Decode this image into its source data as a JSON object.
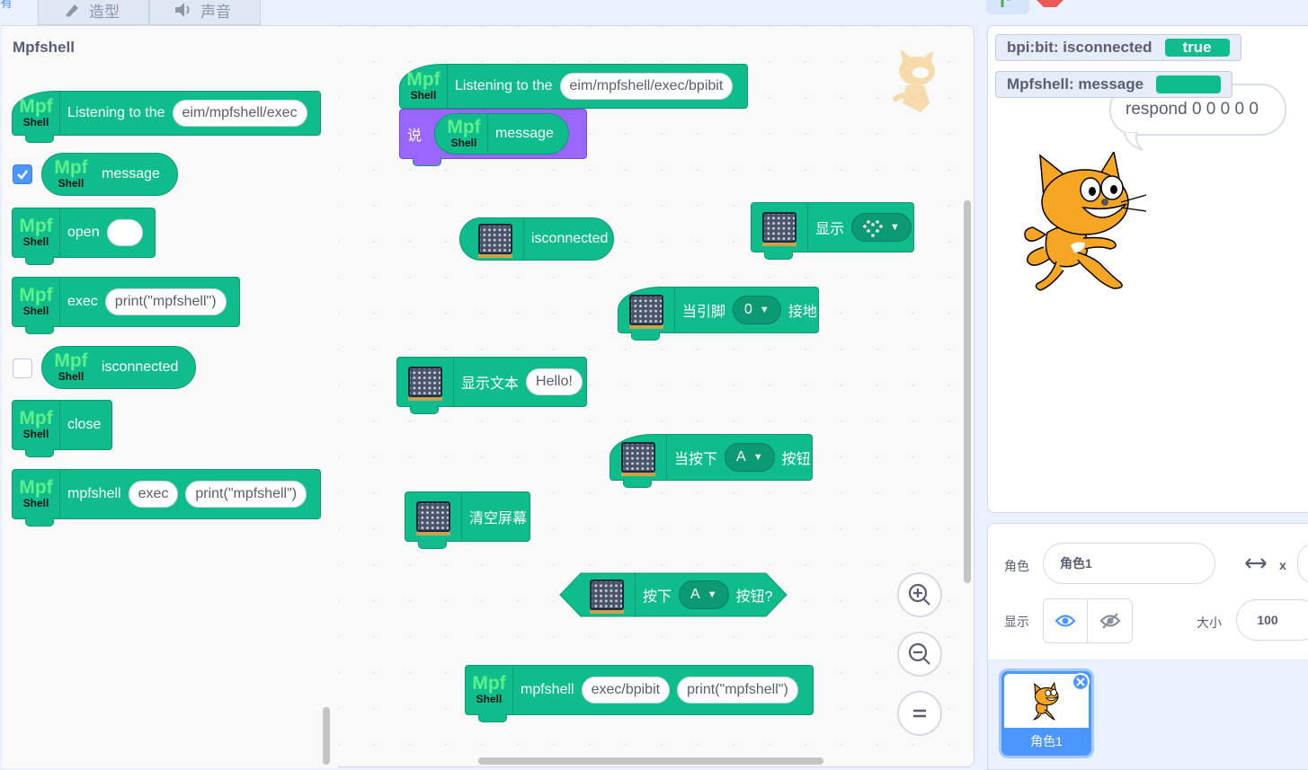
{
  "tabs": {
    "costumes": "造型",
    "sounds": "声音"
  },
  "palette": {
    "title": "Mpfshell",
    "mpf_top": "Mpf",
    "mpf_bottom": "Shell",
    "listen": {
      "label": "Listening to the",
      "value": "eim/mpfshell/exec"
    },
    "message": {
      "label": "message",
      "checked": true
    },
    "open": {
      "label": "open",
      "value": ""
    },
    "exec": {
      "label": "exec",
      "value": "print(\"mpfshell\")"
    },
    "isconnected": {
      "label": "isconnected",
      "checked": false
    },
    "close": {
      "label": "close"
    },
    "mpfshell": {
      "label": "mpfshell",
      "arg1": "exec",
      "arg2": "print(\"mpfshell\")"
    }
  },
  "workspace": {
    "listen": {
      "label": "Listening to the",
      "value": "eim/mpfshell/exec/bpibit"
    },
    "say": {
      "label": "说",
      "reporter": "message"
    },
    "isconnected": {
      "label": "isconnected"
    },
    "show": {
      "label": "显示",
      "icon": "heart-icon"
    },
    "pin": {
      "label1": "当引脚",
      "pin": "0",
      "label2": "接地"
    },
    "showtext": {
      "label": "显示文本",
      "value": "Hello!"
    },
    "whenbutton": {
      "label1": "当按下",
      "button": "A",
      "label2": "按钮"
    },
    "clear": {
      "label": "清空屏幕"
    },
    "pressed": {
      "label1": "按下",
      "button": "A",
      "label2": "按钮?"
    },
    "mpfshell": {
      "label": "mpfshell",
      "arg1": "exec/bpibit",
      "arg2": "print(\"mpfshell\")"
    }
  },
  "zoom": {
    "in": "+",
    "out": "−",
    "reset": "="
  },
  "stage": {
    "monitor1": {
      "label": "bpi:bit: isconnected",
      "value": "true"
    },
    "monitor2": {
      "label": "Mpfshell: message",
      "value": ""
    },
    "speech": "respond 0 0 0 0 0"
  },
  "sprite_info": {
    "sprite_label": "角色",
    "sprite_name": "角色1",
    "x_label": "x",
    "show_label": "显示",
    "size_label": "大小",
    "size_value": "100"
  },
  "sprite_list": {
    "items": [
      {
        "name": "角色1",
        "selected": true
      }
    ]
  },
  "colors": {
    "extension": "#0fbd8c",
    "looks": "#9966ff",
    "accent": "#4c97ff"
  }
}
